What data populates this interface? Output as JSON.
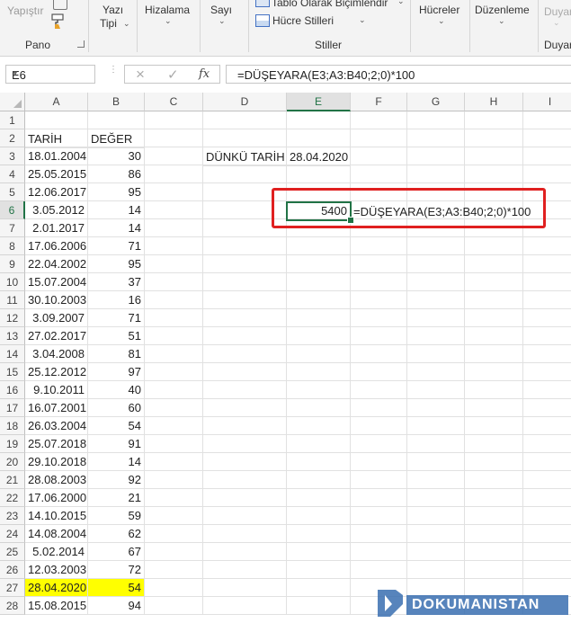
{
  "ribbon": {
    "paste_label": "Yapıştır",
    "clipboard_group": "Pano",
    "font_type_label": "Yazı",
    "font_type_label2": "Tipi",
    "alignment_label": "Hizalama",
    "number_label": "Sayı",
    "format_as_table": "Tablo Olarak Biçimlendir",
    "cell_styles": "Hücre Stilleri",
    "styles_group": "Stiller",
    "cells_label": "Hücreler",
    "editing_label": "Düzenleme",
    "partial_label": "Duyar",
    "partial_group": "Duyar"
  },
  "formula_bar": {
    "name_box": "E6",
    "formula": "=DÜŞEYARA(E3;A3:B40;2;0)*100",
    "cancel_icon": "×",
    "enter_icon": "✓",
    "fx": "fx"
  },
  "columns": [
    "A",
    "B",
    "C",
    "D",
    "E",
    "F",
    "G",
    "H",
    "I"
  ],
  "rows": [
    "1",
    "2",
    "3",
    "4",
    "5",
    "6",
    "7",
    "8",
    "9",
    "10",
    "11",
    "12",
    "13",
    "14",
    "15",
    "16",
    "17",
    "18",
    "19",
    "20",
    "21",
    "22",
    "23",
    "24",
    "25",
    "26",
    "27",
    "28"
  ],
  "headers": {
    "a2": "TARİH",
    "b2": "DEĞER"
  },
  "data": [
    {
      "date": "18.01.2004",
      "value": "30"
    },
    {
      "date": "25.05.2015",
      "value": "86"
    },
    {
      "date": "12.06.2017",
      "value": "95"
    },
    {
      "date": "3.05.2012",
      "value": "14"
    },
    {
      "date": "2.01.2017",
      "value": "14"
    },
    {
      "date": "17.06.2006",
      "value": "71"
    },
    {
      "date": "22.04.2002",
      "value": "95"
    },
    {
      "date": "15.07.2004",
      "value": "37"
    },
    {
      "date": "30.10.2003",
      "value": "16"
    },
    {
      "date": "3.09.2007",
      "value": "71"
    },
    {
      "date": "27.02.2017",
      "value": "51"
    },
    {
      "date": "3.04.2008",
      "value": "81"
    },
    {
      "date": "25.12.2012",
      "value": "97"
    },
    {
      "date": "9.10.2011",
      "value": "40"
    },
    {
      "date": "16.07.2001",
      "value": "60"
    },
    {
      "date": "26.03.2004",
      "value": "54"
    },
    {
      "date": "25.07.2018",
      "value": "91"
    },
    {
      "date": "29.10.2018",
      "value": "14"
    },
    {
      "date": "28.08.2003",
      "value": "92"
    },
    {
      "date": "17.06.2000",
      "value": "21"
    },
    {
      "date": "14.10.2015",
      "value": "59"
    },
    {
      "date": "14.08.2004",
      "value": "62"
    },
    {
      "date": "5.02.2014",
      "value": "67"
    },
    {
      "date": "12.03.2003",
      "value": "72"
    },
    {
      "date": "28.04.2020",
      "value": "54",
      "highlight": true
    },
    {
      "date": "15.08.2015",
      "value": "94"
    }
  ],
  "lookup": {
    "label": "DÜNKÜ TARİH",
    "date": "28.04.2020",
    "result": "5400",
    "formula_text": "=DÜŞEYARA(E3;A3:B40;2;0)*100"
  },
  "watermark": {
    "text": "DOKUMANISTAN"
  },
  "colors": {
    "excel_green": "#217346",
    "highlight": "#ffff00",
    "annotation_red": "#e02020",
    "watermark_blue": "#3a6fb0"
  }
}
